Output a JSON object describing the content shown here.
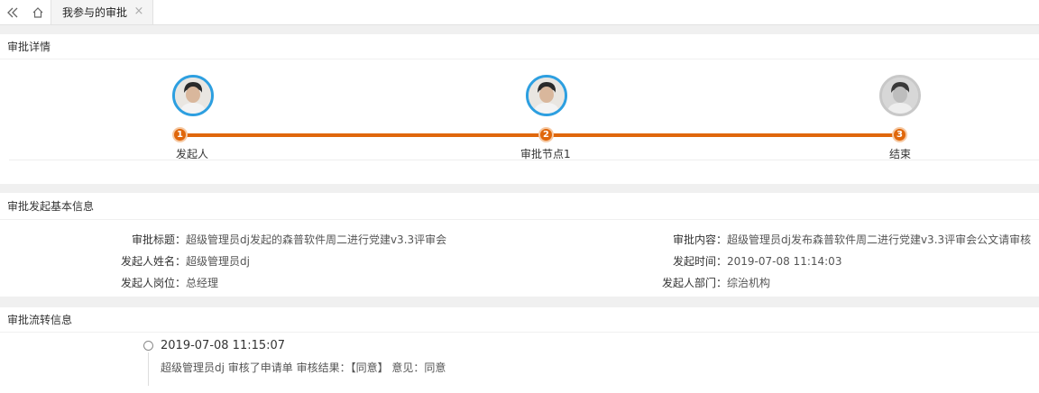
{
  "tabbar": {
    "tab_label": "我参与的审批",
    "close_glyph": "×"
  },
  "detail": {
    "heading": "审批详情",
    "steps": [
      {
        "num": "1",
        "label": "发起人"
      },
      {
        "num": "2",
        "label": "审批节点1"
      },
      {
        "num": "3",
        "label": "结束"
      }
    ]
  },
  "basic": {
    "heading": "审批发起基本信息",
    "title_key": "审批标题：",
    "title_val": "超级管理员dj发起的森普软件周二进行党建v3.3评审会",
    "content_key": "审批内容：",
    "content_val": "超级管理员dj发布森普软件周二进行党建v3.3评审会公文请审核",
    "name_key": "发起人姓名：",
    "name_val": "超级管理员dj",
    "time_key": "发起时间：",
    "time_val": "2019-07-08 11:14:03",
    "post_key": "发起人岗位：",
    "post_val": "总经理",
    "dept_key": "发起人部门：",
    "dept_val": "综治机构"
  },
  "flow": {
    "heading": "审批流转信息",
    "entries": [
      {
        "time": "2019-07-08 11:15:07",
        "text": "超级管理员dj 审核了申请单 审核结果：【同意】 意见：同意"
      }
    ]
  },
  "colors": {
    "accent": "#e0670b",
    "avatar_active": "#2d9fe0",
    "avatar_done": "#c8c8c8"
  }
}
